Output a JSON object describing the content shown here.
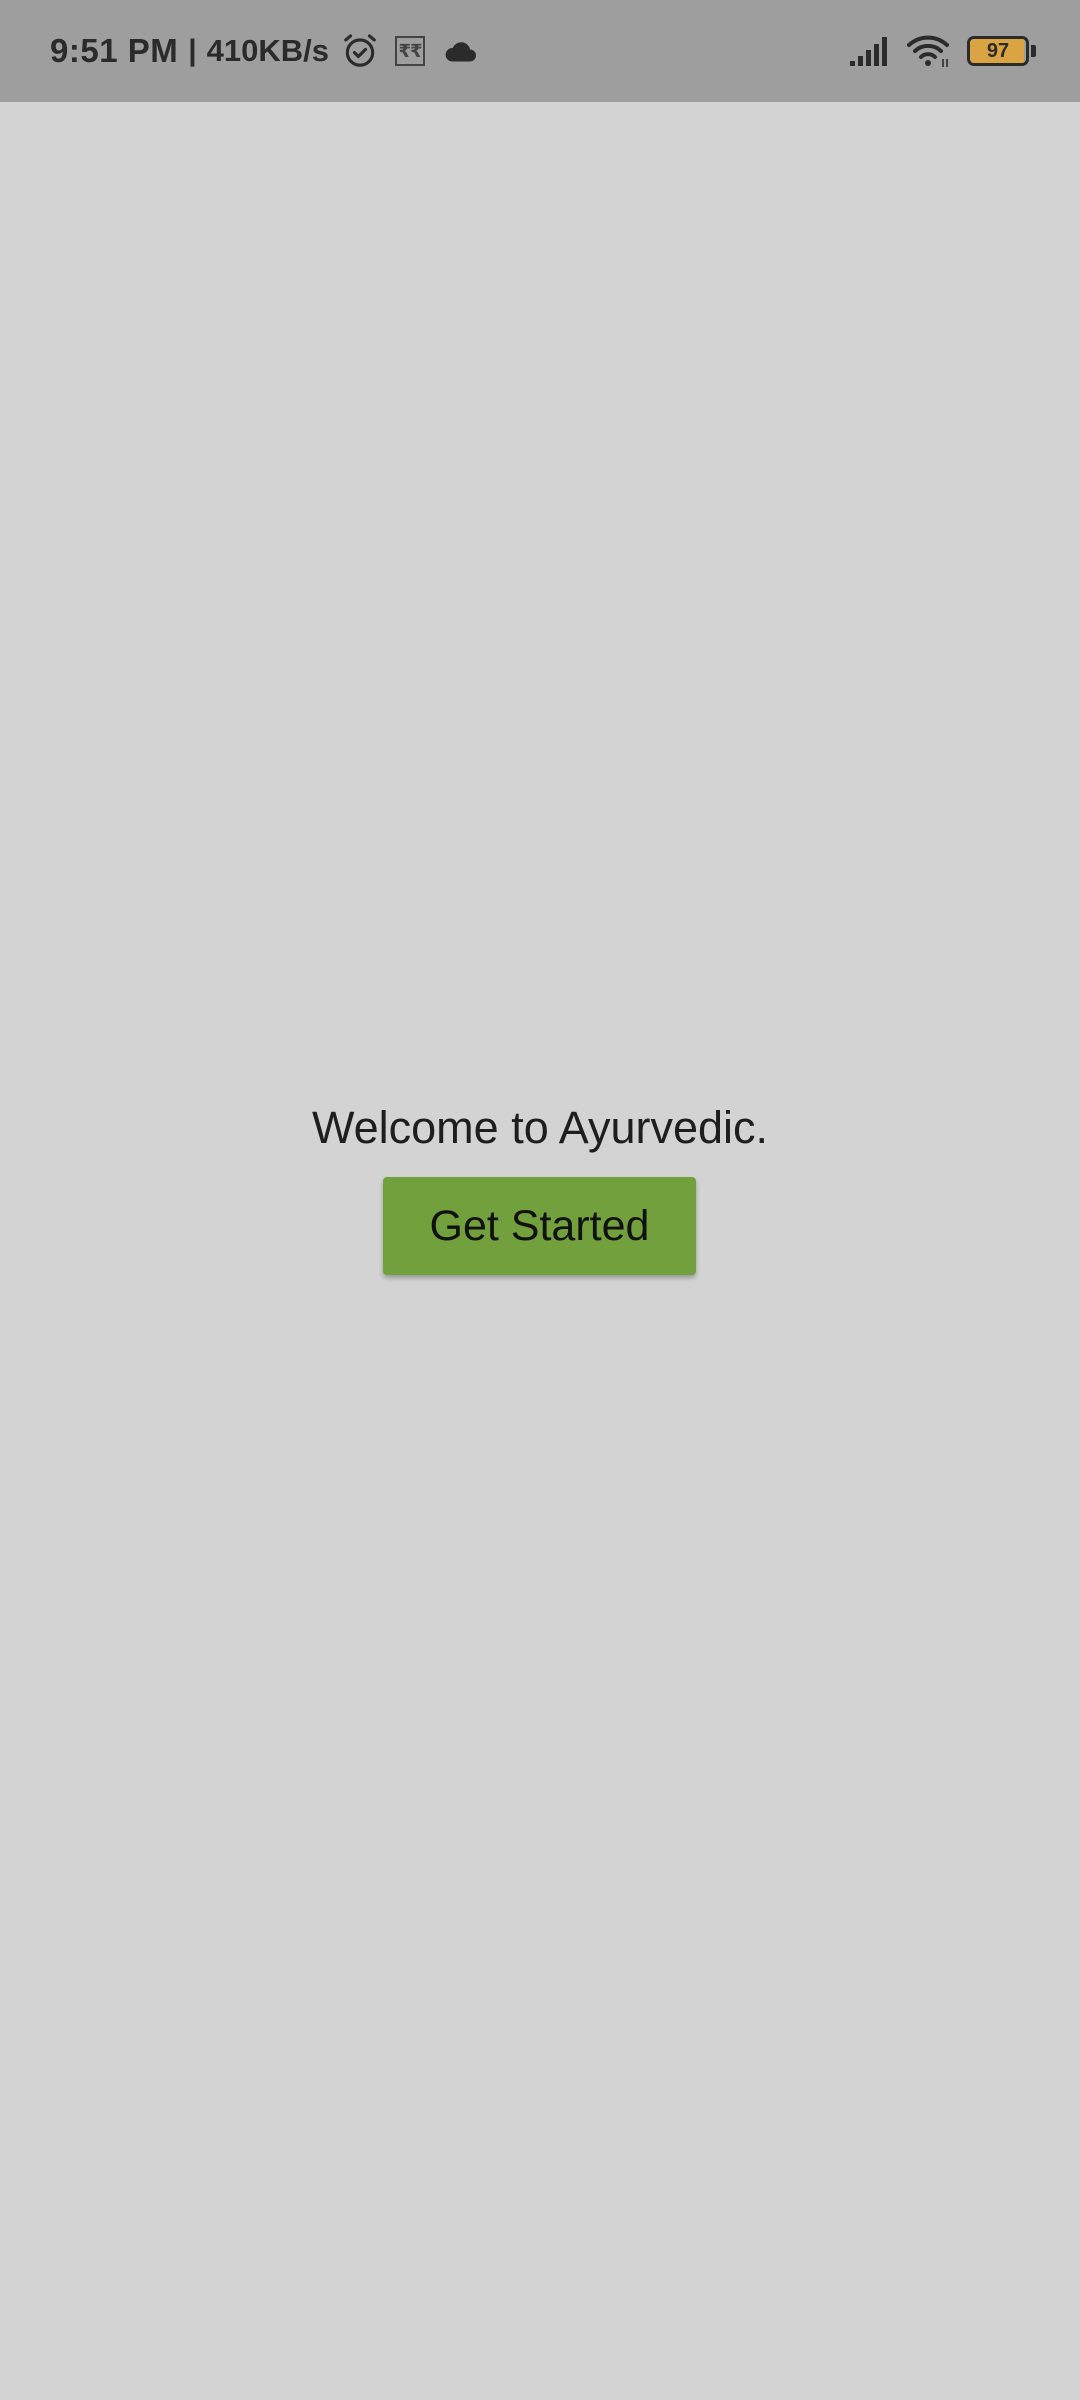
{
  "status_bar": {
    "time": "9:51 PM",
    "separator": "|",
    "net_speed": "410KB/s",
    "rr_label": "₹₹",
    "battery_level": "97",
    "battery_fraction": 0.97,
    "battery_color": "#d9a441",
    "icons": [
      "alarm-icon",
      "rr-box-icon",
      "cloud-icon",
      "signal-icon",
      "wifi-icon",
      "battery-icon"
    ]
  },
  "main": {
    "welcome_text": "Welcome to Ayurvedic.",
    "button_label": "Get Started",
    "button_color": "#72a03d",
    "background_color": "#d3d3d3"
  }
}
